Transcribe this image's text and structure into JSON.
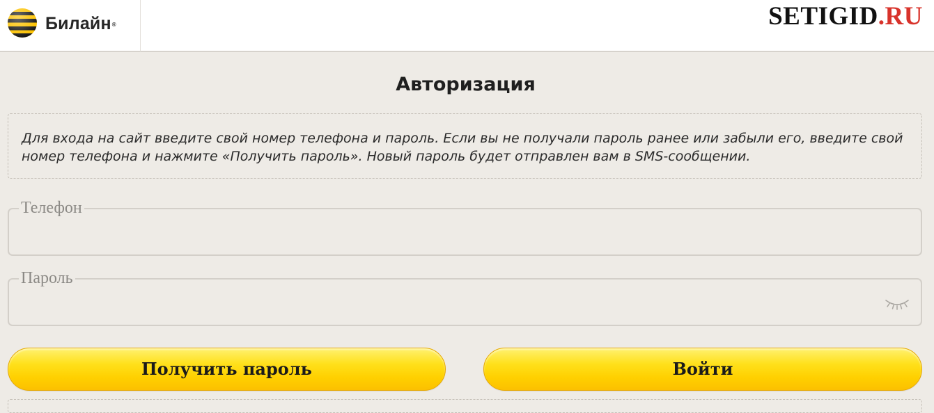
{
  "header": {
    "brand_name": "Билайн",
    "brand_reg": "®",
    "watermark_main": "SETIGID",
    "watermark_suffix": ".RU"
  },
  "page": {
    "title": "Авторизация",
    "info_text": "Для входа на сайт введите свой номер телефона и пароль. Если вы не получали пароль ранее или забыли его, введите свой номер телефона и нажмите «Получить пароль». Новый пароль будет отправлен вам в SMS-сообщении."
  },
  "form": {
    "phone_label": "Телефон",
    "phone_value": "",
    "password_label": "Пароль",
    "password_value": "",
    "get_password_label": "Получить пароль",
    "login_label": "Войти"
  },
  "icons": {
    "logo": "beeline-stripes-logo-icon",
    "password_toggle": "eye-closed-icon"
  },
  "colors": {
    "background": "#eeebe6",
    "button_yellow": "#ffd700",
    "watermark_red": "#d8332b",
    "logo_yellow": "#fcc200",
    "logo_black": "#1a1a1a"
  }
}
